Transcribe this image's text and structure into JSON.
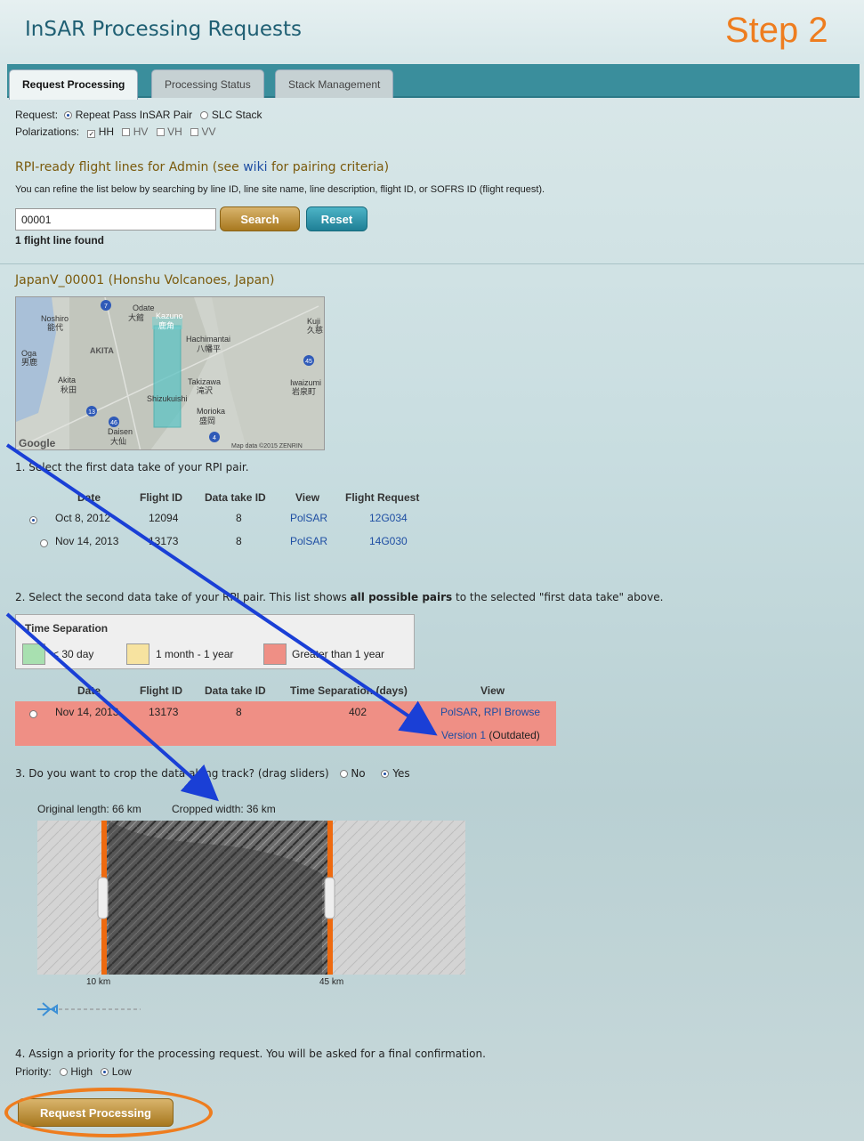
{
  "header": {
    "title": "InSAR Processing Requests",
    "step": "Step 2"
  },
  "tabs": [
    "Request Processing",
    "Processing Status",
    "Stack Management"
  ],
  "request": {
    "label": "Request:",
    "opt1": "Repeat Pass InSAR Pair",
    "opt2": "SLC Stack"
  },
  "pol": {
    "label": "Polarizations:",
    "hh": "HH",
    "hv": "HV",
    "vh": "VH",
    "vv": "VV"
  },
  "flight": {
    "heading_pre": "RPI-ready flight lines for Admin (see ",
    "heading_link": "wiki",
    "heading_post": " for pairing criteria)",
    "help": "You can refine the list below by searching by line ID, line site name, line description, flight ID, or SOFRS ID (flight request).",
    "search_value": "00001",
    "search_btn": "Search",
    "reset_btn": "Reset",
    "found": "1 flight line found"
  },
  "line": {
    "title": "JapanV_00001 (Honshu Volcanoes, Japan)"
  },
  "map": {
    "labels": [
      "Odate",
      "大館",
      "Kazuno",
      "鹿角",
      "Noshiro",
      "能代",
      "AKITA",
      "Hachimantai",
      "八幡平",
      "Oga",
      "男鹿",
      "Akita",
      "秋田",
      "Takizawa",
      "滝沢",
      "Kuji",
      "久慈",
      "Iwaizumi",
      "岩泉町",
      "Shizukuishi",
      "Morioka",
      "盛岡",
      "Daisen",
      "大仙",
      "Google",
      "Map data ©2015 ZENRIN"
    ],
    "routes": [
      "7",
      "45",
      "13",
      "46",
      "4"
    ]
  },
  "step1": {
    "title": "1. Select the first data take of your RPI pair.",
    "headers": [
      "Date",
      "Flight ID",
      "Data take ID",
      "View",
      "Flight Request"
    ],
    "rows": [
      [
        "Oct 8, 2012",
        "12094",
        "8",
        "PolSAR",
        "12G034"
      ],
      [
        "Nov 14, 2013",
        "13173",
        "8",
        "PolSAR",
        "14G030"
      ]
    ]
  },
  "step2": {
    "title_pre": "2. Select the second data take of your RPI pair. This list shows ",
    "title_bold": "all possible pairs",
    "title_post": " to the selected \"first data take\" above.",
    "legend_title": "Time Separation",
    "leg1": "< 30 day",
    "leg2": "1 month - 1 year",
    "leg3": "Greater than 1 year",
    "headers": [
      "Date",
      "Flight ID",
      "Data take ID",
      "Time Separation (days)",
      "View"
    ],
    "row": {
      "date": "Nov 14, 2013",
      "flight": "13173",
      "take": "8",
      "sep": "402",
      "view1": "PolSAR",
      "view_sep": ",",
      "view2": "RPI Browse",
      "version": "Version 1",
      "outdated": "(Outdated)"
    }
  },
  "step3": {
    "title": "3. Do you want to crop the data along track? (drag sliders)",
    "no": "No",
    "yes": "Yes",
    "orig": "Original length: 66 km",
    "crop": "Cropped width: 36 km",
    "left_km": "10 km",
    "right_km": "45 km"
  },
  "step4": {
    "title": "4. Assign a priority for the processing request. You will be asked for a final confirmation.",
    "label": "Priority:",
    "high": "High",
    "low": "Low",
    "button": "Request Processing"
  },
  "colors": {
    "accent": "#ee7d1f",
    "teal": "#3a8e9c",
    "green": "#a8e0b0",
    "yellow": "#f7e3a0",
    "red": "#ef8f85",
    "arrow": "#1a3fd6"
  }
}
